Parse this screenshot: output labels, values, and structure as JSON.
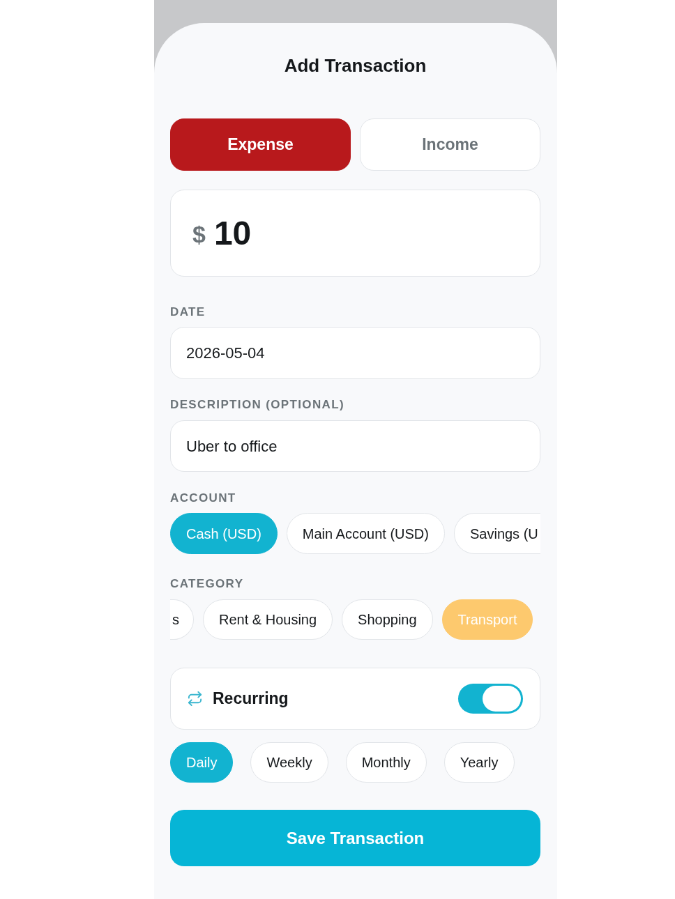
{
  "title": "Add Transaction",
  "type_tabs": [
    {
      "label": "Expense",
      "selected": true
    },
    {
      "label": "Income",
      "selected": false
    }
  ],
  "amount": {
    "currency": "$",
    "value": "10"
  },
  "date": {
    "label": "DATE",
    "value": "2026-05-04"
  },
  "description": {
    "label": "DESCRIPTION (OPTIONAL)",
    "value": "Uber to office"
  },
  "account": {
    "label": "ACCOUNT",
    "options": [
      {
        "label": "Cash (USD)",
        "selected": true,
        "cut_off": false
      },
      {
        "label": "Main Account (USD)",
        "selected": false,
        "cut_off": false
      },
      {
        "label": "Savings (U",
        "selected": false,
        "cut_off": true
      }
    ]
  },
  "category": {
    "label": "CATEGORY",
    "options": [
      {
        "label": "s",
        "selected": false,
        "cut_off": true
      },
      {
        "label": "Rent & Housing",
        "selected": false,
        "cut_off": false
      },
      {
        "label": "Shopping",
        "selected": false,
        "cut_off": false
      },
      {
        "label": "Transport",
        "selected": true,
        "cut_off": false
      }
    ]
  },
  "recurring": {
    "label": "Recurring",
    "on": true
  },
  "frequency": [
    {
      "label": "Daily",
      "selected": true
    },
    {
      "label": "Weekly",
      "selected": false
    },
    {
      "label": "Monthly",
      "selected": false
    },
    {
      "label": "Yearly",
      "selected": false
    }
  ],
  "save_button": "Save Transaction"
}
